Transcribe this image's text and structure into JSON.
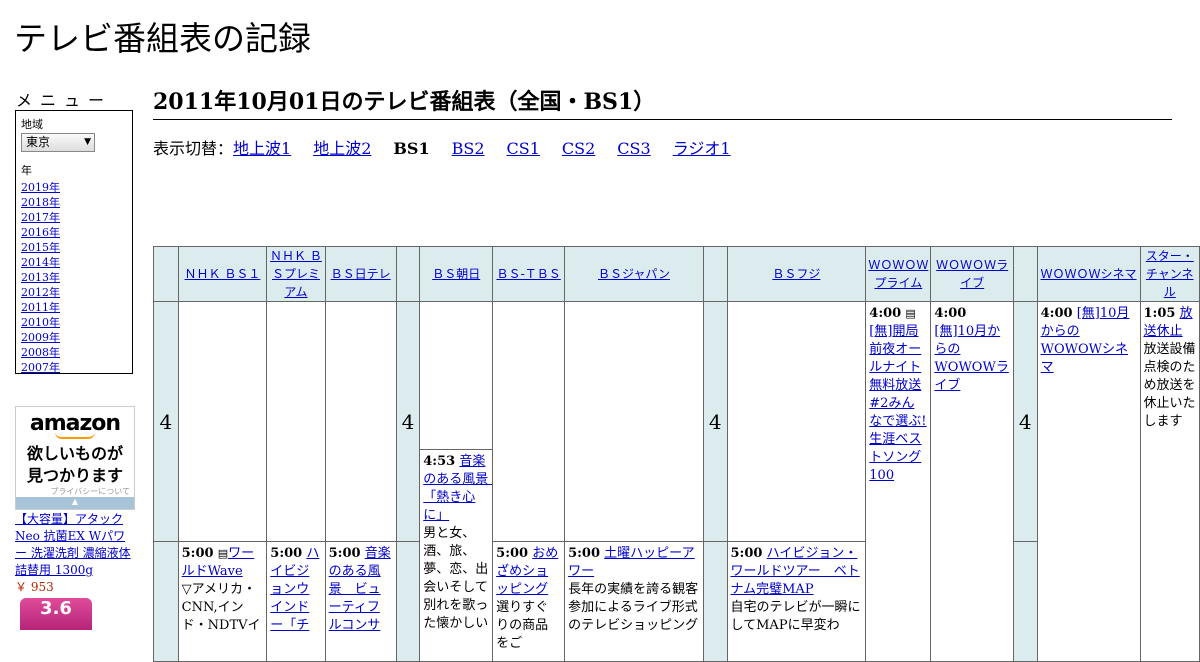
{
  "site": {
    "title": "テレビ番組表の記録"
  },
  "menu": {
    "title": "メニュー",
    "region_label": "地域",
    "region_value": "東京",
    "year_label": "年",
    "years": [
      "2019年",
      "2018年",
      "2017年",
      "2016年",
      "2015年",
      "2014年",
      "2013年",
      "2012年",
      "2011年",
      "2010年",
      "2009年",
      "2008年",
      "2007年"
    ]
  },
  "ad": {
    "logo": "amazon",
    "message_1": "欲しいものが",
    "message_2": "見つかります",
    "privacy": "プライバシーについて",
    "product": "【大容量】アタック Neo 抗菌EX Wパワー 洗濯洗剤 濃縮液体 詰替用 1300g",
    "price": "￥ 953",
    "image_text": "3.6"
  },
  "page": {
    "title": "2011年10月01日のテレビ番組表（全国・BS1）"
  },
  "switcher": {
    "label": "表示切替：",
    "items": [
      {
        "label": "地上波1",
        "current": false
      },
      {
        "label": "地上波2",
        "current": false
      },
      {
        "label": "BS1",
        "current": true
      },
      {
        "label": "BS2",
        "current": false
      },
      {
        "label": "CS1",
        "current": false
      },
      {
        "label": "CS2",
        "current": false
      },
      {
        "label": "CS3",
        "current": false
      },
      {
        "label": "ラジオ1",
        "current": false
      }
    ]
  },
  "channels": [
    "ＮＨＫ ＢＳ１",
    "ＮＨＫ ＢＳプレミアム",
    "ＢＳ日テレ",
    "ＢＳ朝日",
    "ＢＳ-ＴＢＳ",
    "ＢＳジャパン",
    "ＢＳフジ",
    "ＷＯＷＯＷプライム",
    "ＷＯＷＯＷライブ",
    "ＷＯＷＯＷシネマ",
    "スター・チャンネル"
  ],
  "hour": "4",
  "programs": {
    "wowow_prime": {
      "time": "4:00",
      "tag": "[無]",
      "title": "開局前夜オールナイト無料放送#2みんなで選ぶ!生涯ベストソング100"
    },
    "wowow_live": {
      "time": "4:00",
      "tag": "[無]",
      "title": "10月からのWOWOWライブ"
    },
    "wowow_cinema": {
      "time": "4:00",
      "tag": "[無]",
      "title": "10月からのWOWOWシネマ"
    },
    "star": {
      "time": "1:05",
      "title": "放送休止",
      "desc": "放送設備点検のため放送を休止いたします"
    },
    "bs_asahi_453": {
      "time": "4:53",
      "title": "音楽のある風景　「熱き心に」",
      "desc": "男と女、酒、旅、夢、恋、出会いそして別れを歌った懐かしい"
    },
    "nhk_bs1_500": {
      "time": "5:00",
      "title": "ワールドWave",
      "desc": "▽アメリカ・CNN,インド・NDTVイ"
    },
    "nhk_prem_500": {
      "time": "5:00",
      "title": "ハイビジョンウインドー「チ"
    },
    "bs_ntv_500": {
      "time": "5:00",
      "title": "音楽のある風景　ビューティフルコンサ"
    },
    "bs_tbs_500": {
      "time": "5:00",
      "title": "おめざめショッピング",
      "desc": "選りすぐりの商品をご"
    },
    "bs_japan_500": {
      "time": "5:00",
      "title": "土曜ハッピーアワー",
      "desc": "長年の実績を誇る観客参加によるライブ形式のテレビショッピング"
    },
    "bs_fuji_500": {
      "time": "5:00",
      "title": "ハイビジョン・ワールドツアー　ベトナム完璧MAP",
      "desc": "自宅のテレビが一瞬にしてMAPに早変わ"
    }
  }
}
